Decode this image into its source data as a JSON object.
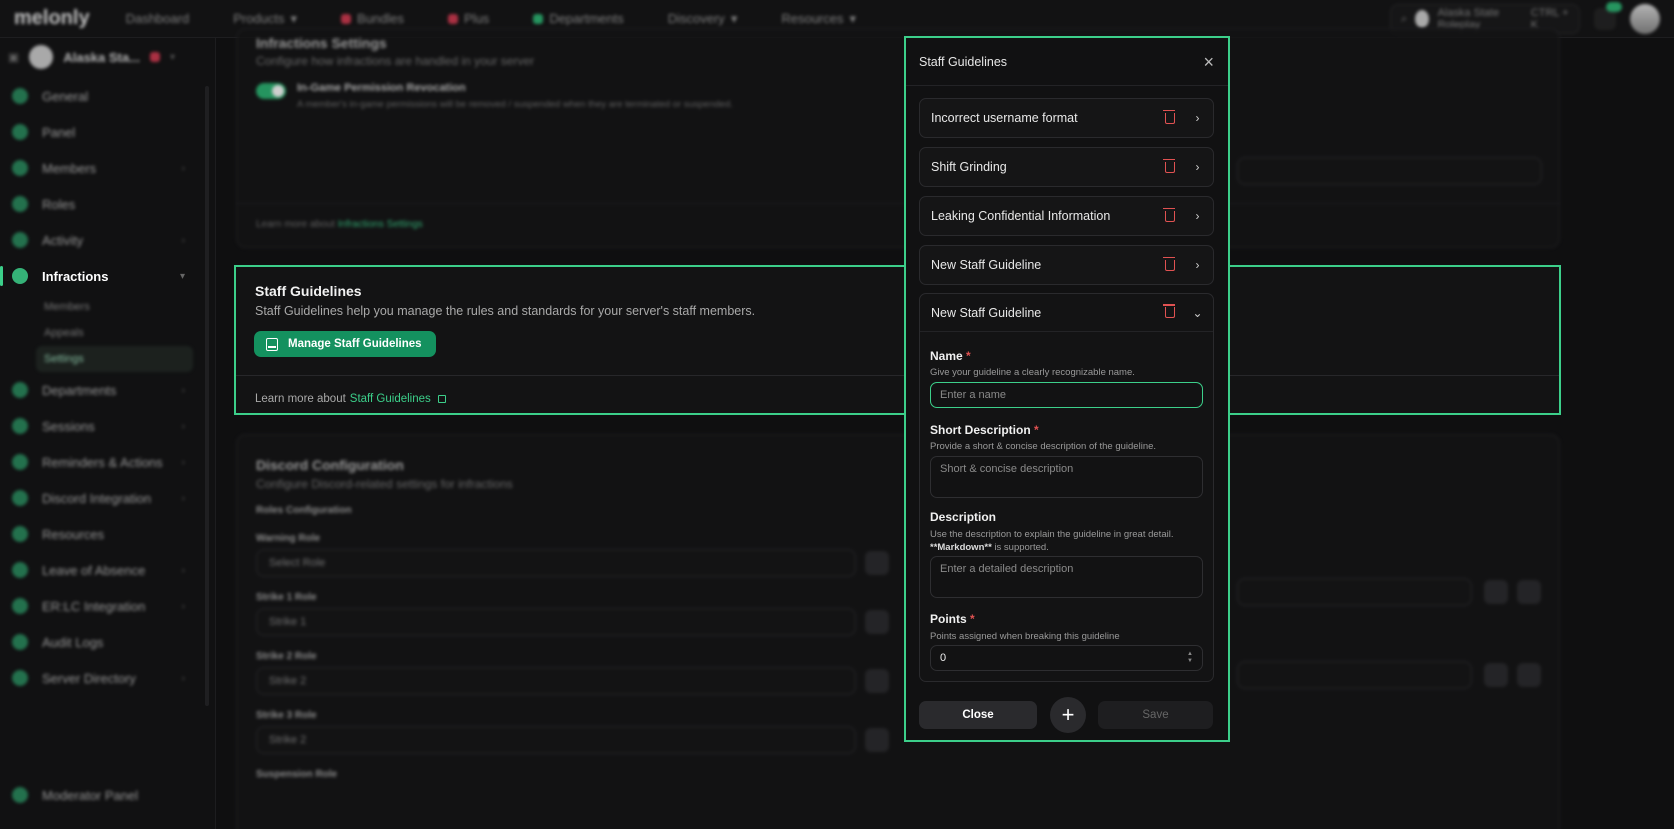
{
  "topnav": {
    "logo": "melonly",
    "items": [
      "Dashboard",
      "Products",
      "Bundles",
      "Plus",
      "Departments",
      "Discovery",
      "Resources"
    ],
    "search_text": "Alaska State Roleplay",
    "search_shortcut": "CTRL + K"
  },
  "sidebar": {
    "server_name": "Alaska Sta...",
    "items": [
      {
        "label": "General"
      },
      {
        "label": "Panel"
      },
      {
        "label": "Members"
      },
      {
        "label": "Roles"
      },
      {
        "label": "Activity"
      },
      {
        "label": "Infractions"
      }
    ],
    "sub_items": [
      "Members",
      "Appeals",
      "Settings"
    ],
    "items2": [
      {
        "label": "Departments"
      },
      {
        "label": "Sessions"
      },
      {
        "label": "Reminders & Actions"
      },
      {
        "label": "Discord Integration"
      },
      {
        "label": "Resources"
      },
      {
        "label": "Leave of Absence"
      },
      {
        "label": "ER:LC Integration"
      },
      {
        "label": "Audit Logs"
      },
      {
        "label": "Server Directory"
      }
    ],
    "bottom_label": "Moderator Panel"
  },
  "background": {
    "infractions_title": "Infractions Settings",
    "infractions_sub": "Configure how infractions are handled in your server",
    "toggle_label": "In-Game Permission Revocation",
    "toggle_desc": "A member's in-game permissions will be removed / suspended when they are terminated or suspended.",
    "learn_infractions_prefix": "Learn more about",
    "learn_infractions_link": "Infractions Settings",
    "discord_title": "Discord Configuration",
    "discord_sub": "Configure Discord-related settings for infractions",
    "roles_config": "Roles Configuration",
    "warning_role": "Warning Role",
    "warning_placeholder": "Select Role",
    "strike1_role": "Strike 1 Role",
    "strike1_value": "Strike 1",
    "strike2_role": "Strike 2 Role",
    "strike2_value": "Strike 2",
    "strike3_role": "Strike 3 Role",
    "strike3_value": "Strike 2",
    "suspension_role": "Suspension Role"
  },
  "staff_guidelines_card": {
    "title": "Staff Guidelines",
    "description": "Staff Guidelines help you manage the rules and standards for your server's staff members.",
    "manage_button": "Manage Staff Guidelines",
    "learn_prefix": "Learn more about",
    "learn_link": "Staff Guidelines"
  },
  "modal": {
    "title": "Staff Guidelines",
    "guidelines": [
      {
        "label": "Incorrect username format"
      },
      {
        "label": "Shift Grinding"
      },
      {
        "label": "Leaking Confidential Information"
      },
      {
        "label": "New Staff Guideline"
      }
    ],
    "expanded": {
      "label": "New Staff Guideline",
      "name_label": "Name",
      "name_help": "Give your guideline a clearly recognizable name.",
      "name_placeholder": "Enter a name",
      "short_label": "Short Description",
      "short_help": "Provide a short & concise description of the guideline.",
      "short_placeholder": "Short & concise description",
      "desc_label": "Description",
      "desc_help_1": "Use the description to explain the guideline in great detail.",
      "desc_help_2_bold": "**Markdown**",
      "desc_help_2_rest": " is supported.",
      "desc_placeholder": "Enter a detailed description",
      "points_label": "Points",
      "points_help": "Points assigned when breaking this guideline",
      "points_value": "0",
      "required_mark": "*"
    },
    "close_button": "Close",
    "add_button": "+",
    "save_button": "Save"
  },
  "colors": {
    "accent": "#3ccf8a",
    "primary_button": "#14915f",
    "danger": "#e05252"
  }
}
